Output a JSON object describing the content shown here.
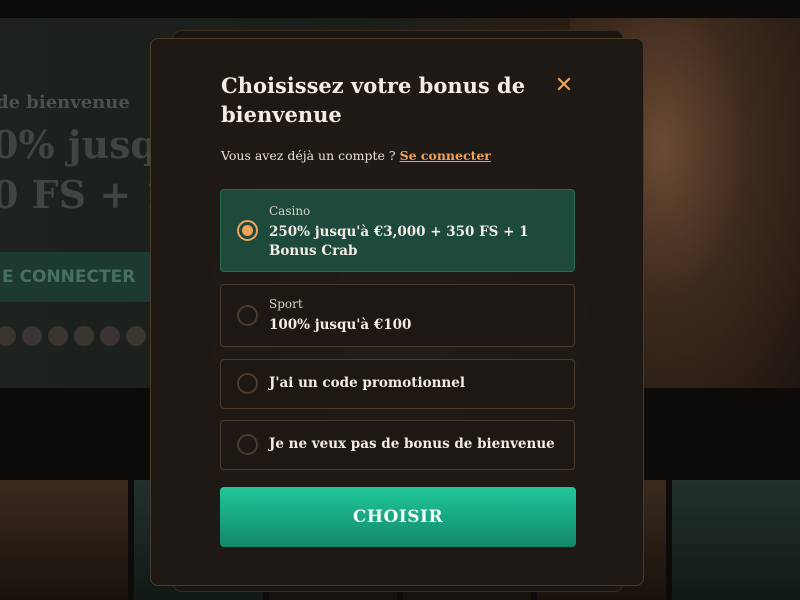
{
  "background": {
    "welcome_text": "de bienvenue",
    "hero_line1": "0% jusq",
    "hero_line2": "0 FS + 1",
    "login_label": "E CONNECTER"
  },
  "modal": {
    "title": "Choisissez votre bonus de bienvenue",
    "close_icon": "close-icon",
    "account_prompt": "Vous avez déjà un compte ?",
    "login_link": "Se connecter",
    "options": [
      {
        "category": "Casino",
        "text": "250% jusqu'à €3,000 + 350 FS + 1 Bonus Crab",
        "selected": true
      },
      {
        "category": "Sport",
        "text": "100% jusqu'à €100",
        "selected": false
      },
      {
        "category": "",
        "text": "J'ai un code promotionnel",
        "selected": false
      },
      {
        "category": "",
        "text": "Je ne veux pas de bonus de bienvenue",
        "selected": false
      }
    ],
    "choose_label": "CHOISIR"
  },
  "colors": {
    "accent": "#f0a25a",
    "selected_bg": "#1d4a3a",
    "button": "#18a880",
    "modal_bg": "#1e1915"
  }
}
